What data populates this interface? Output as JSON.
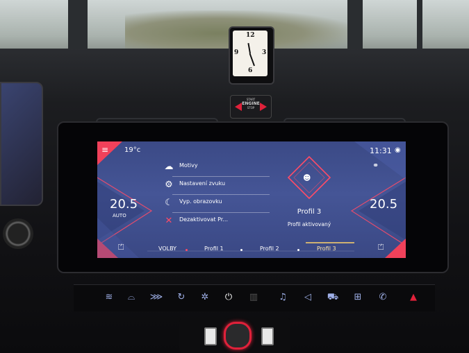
{
  "clock": {
    "numerals": [
      "12",
      "3",
      "6",
      "9"
    ]
  },
  "engine_button": {
    "line1": "START",
    "line2": "ENGINE",
    "line3": "STOP"
  },
  "status_bar": {
    "outside_temp": "19°c",
    "time": "11:31"
  },
  "climate": {
    "left_temp": "20.5",
    "left_mode": "AUTO",
    "right_temp": "20.5"
  },
  "menu": {
    "items": [
      {
        "label": "Motivy",
        "icon": "palette-icon"
      },
      {
        "label": "Nastavení zvuku",
        "icon": "sound-settings-icon"
      },
      {
        "label": "Vyp. obrazovku",
        "icon": "moon-icon"
      },
      {
        "label": "Dezaktivovat Pr...",
        "icon": "close-icon"
      }
    ]
  },
  "profile_panel": {
    "title": "Profil 3",
    "status": "Profil aktivovaný"
  },
  "bottom_bar": {
    "options_label": "VOLBY",
    "tabs": [
      "Profil 1",
      "Profil 2",
      "Profil 3"
    ],
    "active_tab": "Profil 3"
  },
  "colors": {
    "accent": "#e0213a",
    "screen_bg": "#4051900",
    "highlight": "#ffd36b"
  }
}
